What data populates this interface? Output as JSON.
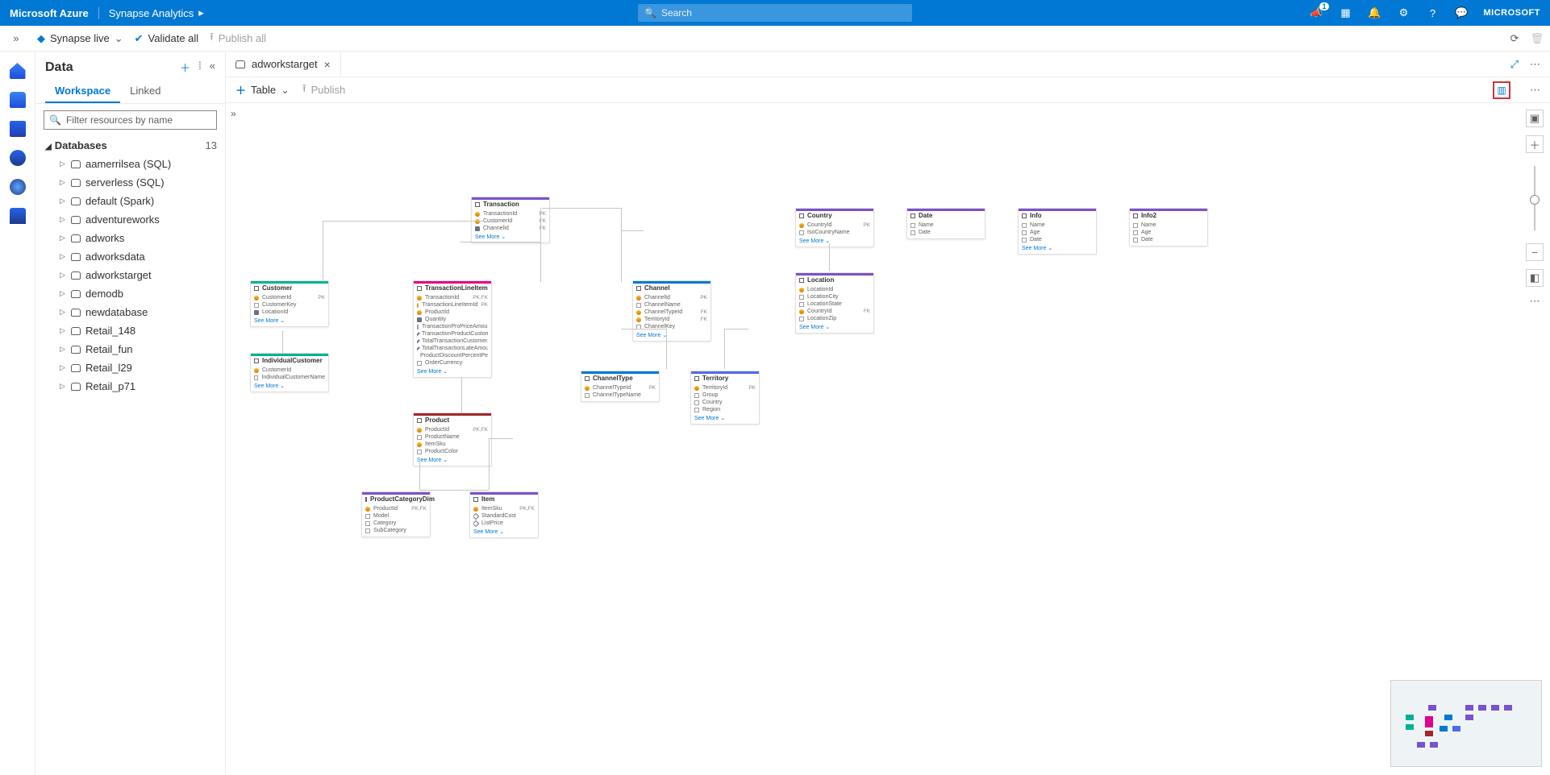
{
  "topbar": {
    "brand": "Microsoft Azure",
    "product": "Synapse Analytics",
    "search_placeholder": "Search",
    "notification_count": "1",
    "account": "MICROSOFT"
  },
  "cmdbar": {
    "live": "Synapse live",
    "validate": "Validate all",
    "publish": "Publish all"
  },
  "panel": {
    "title": "Data",
    "tab_workspace": "Workspace",
    "tab_linked": "Linked",
    "filter_placeholder": "Filter resources by name",
    "group_label": "Databases",
    "group_count": "13",
    "databases": [
      "aamerrilsea (SQL)",
      "serverless (SQL)",
      "default (Spark)",
      "adventureworks",
      "adworks",
      "adworksdata",
      "adworkstarget",
      "demodb",
      "newdatabase",
      "Retail_148",
      "Retail_fun",
      "Retail_l29",
      "Retail_p71"
    ]
  },
  "editor": {
    "tab_label": "adworkstarget",
    "toolbar_table": "Table",
    "toolbar_publish": "Publish"
  },
  "entities": {
    "transaction": {
      "name": "Transaction",
      "color": "#7a52cc",
      "rows": [
        [
          "key",
          "TransactionId",
          "PK"
        ],
        [
          "key",
          "CustomerId",
          "FK"
        ],
        [
          "num",
          "ChannelId",
          "FK"
        ]
      ],
      "see": true
    },
    "customer": {
      "name": "Customer",
      "color": "#00b294",
      "rows": [
        [
          "key",
          "CustomerId",
          "PK"
        ],
        [
          "txt",
          "CustomerKey",
          ""
        ],
        [
          "num",
          "LocationId",
          ""
        ]
      ],
      "see": true
    },
    "ind_customer": {
      "name": "IndividualCustomer",
      "color": "#00b294",
      "rows": [
        [
          "key",
          "CustomerId",
          ""
        ],
        [
          "txt",
          "IndividualCustomerName",
          ""
        ]
      ],
      "see": true
    },
    "tli": {
      "name": "TransactionLineItem",
      "color": "#e3008c",
      "rows": [
        [
          "key",
          "TransactionId",
          "PK,FK"
        ],
        [
          "key",
          "TransactionLineItemId",
          "PK"
        ],
        [
          "key",
          "ProductId",
          ""
        ],
        [
          "num",
          "Quantity",
          ""
        ],
        [
          "txt",
          "TransactionProPriceAmount",
          ""
        ],
        [
          "chk",
          "TransactionProductCustomer...",
          ""
        ],
        [
          "chk",
          "TotalTransactionCustomerAmo...",
          ""
        ],
        [
          "chk",
          "TotalTransactionLateAmount...",
          ""
        ],
        [
          "num",
          "ProductDiscountPercentPer...",
          ""
        ],
        [
          "txt",
          "OrderCurrency",
          ""
        ]
      ],
      "see": true
    },
    "product": {
      "name": "Product",
      "color": "#a4262c",
      "rows": [
        [
          "key",
          "ProductId",
          "PK,FK"
        ],
        [
          "txt",
          "ProductName",
          ""
        ],
        [
          "key",
          "ItemSku",
          ""
        ],
        [
          "txt",
          "ProductColor",
          ""
        ]
      ],
      "see": true
    },
    "prodcat": {
      "name": "ProductCategoryDim",
      "color": "#7a52cc",
      "rows": [
        [
          "key",
          "ProductId",
          "PK,FK"
        ],
        [
          "txt",
          "Model",
          ""
        ],
        [
          "txt",
          "Category",
          ""
        ],
        [
          "txt",
          "SubCategory",
          ""
        ]
      ],
      "see": false
    },
    "item": {
      "name": "Item",
      "color": "#7a52cc",
      "rows": [
        [
          "key",
          "ItemSku",
          "PK,FK"
        ],
        [
          "chk",
          "StandardCost",
          ""
        ],
        [
          "chk",
          "ListPrice",
          ""
        ]
      ],
      "see": true
    },
    "channel": {
      "name": "Channel",
      "color": "#0078d4",
      "rows": [
        [
          "key",
          "ChannelId",
          "PK"
        ],
        [
          "txt",
          "ChannelName",
          ""
        ],
        [
          "key",
          "ChannelTypeId",
          "FK"
        ],
        [
          "key",
          "TerritoryId",
          "FK"
        ],
        [
          "txt",
          "ChannelKey",
          ""
        ]
      ],
      "see": true
    },
    "channeltype": {
      "name": "ChannelType",
      "color": "#0078d4",
      "rows": [
        [
          "key",
          "ChannelTypeId",
          "PK"
        ],
        [
          "txt",
          "ChannelTypeName",
          ""
        ]
      ]
    },
    "territory": {
      "name": "Territory",
      "color": "#4f6bed",
      "rows": [
        [
          "key",
          "TerritoryId",
          "PK"
        ],
        [
          "txt",
          "Group",
          ""
        ],
        [
          "txt",
          "Country",
          ""
        ],
        [
          "txt",
          "Region",
          ""
        ]
      ],
      "see": true
    },
    "country": {
      "name": "Country",
      "color": "#7a52cc",
      "rows": [
        [
          "key",
          "CountryId",
          "PK"
        ],
        [
          "txt",
          "IsoCountryName",
          ""
        ]
      ],
      "see": true
    },
    "location": {
      "name": "Location",
      "color": "#7a52cc",
      "rows": [
        [
          "key",
          "LocationId",
          ""
        ],
        [
          "txt",
          "LocationCity",
          ""
        ],
        [
          "txt",
          "LocationState",
          ""
        ],
        [
          "key",
          "CountryId",
          "FK"
        ],
        [
          "txt",
          "LocationZip",
          ""
        ]
      ],
      "see": true
    },
    "date": {
      "name": "Date",
      "color": "#7a52cc",
      "rows": [
        [
          "txt",
          "Name",
          ""
        ],
        [
          "txt",
          "Date",
          ""
        ]
      ]
    },
    "info": {
      "name": "Info",
      "color": "#7a52cc",
      "rows": [
        [
          "txt",
          "Name",
          ""
        ],
        [
          "txt",
          "Age",
          ""
        ],
        [
          "txt",
          "Date",
          ""
        ]
      ],
      "see": true
    },
    "info2": {
      "name": "Info2",
      "color": "#7a52cc",
      "rows": [
        [
          "txt",
          "Name",
          ""
        ],
        [
          "txt",
          "Age",
          ""
        ],
        [
          "txt",
          "Date",
          ""
        ]
      ]
    }
  },
  "see_more": "See More"
}
